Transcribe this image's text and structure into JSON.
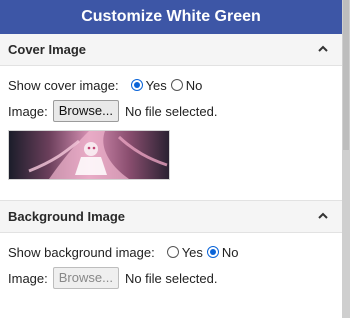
{
  "panel": {
    "title": "Customize White Green"
  },
  "cover": {
    "heading": "Cover Image",
    "show_label": "Show cover image:",
    "yes": "Yes",
    "no": "No",
    "selected": "yes",
    "image_label": "Image:",
    "browse": "Browse...",
    "file_status": "No file selected."
  },
  "background": {
    "heading": "Background Image",
    "show_label": "Show background image:",
    "yes": "Yes",
    "no": "No",
    "selected": "no",
    "image_label": "Image:",
    "browse": "Browse...",
    "file_status": "No file selected."
  },
  "colors": {
    "title_bar": "#3d56a6",
    "radio_checked": "#0a64d8"
  },
  "icons": {
    "collapse": "chevron-up-icon"
  }
}
